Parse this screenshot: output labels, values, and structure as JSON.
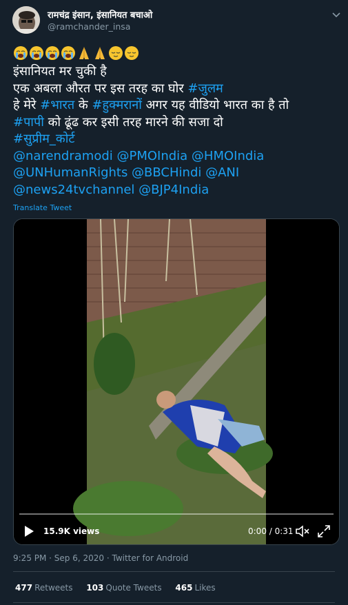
{
  "author": {
    "display_name": "रामचंद्र इंसान, इंसानियत बचाओ",
    "handle": "@ramchander_insa"
  },
  "emojis": [
    "crying-face",
    "crying-face",
    "crying-face",
    "crying-face",
    "folded-hands",
    "folded-hands",
    "relieved-face",
    "relieved-face"
  ],
  "tweet": {
    "line1": " इंसानियत मर चुकी है",
    "line2_text": "एक अबला औरत पर इस तरह का घोर ",
    "line2_tag": "#जुलम",
    "line3_a": " हे मेरे ",
    "line3_tag1": "#भारत",
    "line3_b": " के ",
    "line3_tag2": "#हुक्मरानों",
    "line3_c": " अगर यह वीडियो भारत का है तो",
    "line4_tag": "#पापी",
    "line4_text": " को ढूंढ कर इसी तरह मारने की सजा दो",
    "line5_tag": " #सुप्रीम_कोर्ट",
    "mentions1": "@narendramodi @PMOIndia @HMOIndia",
    "mentions2": "@UNHumanRights @BBCHindi @ANI",
    "mentions3": "@news24tvchannel @BJP4India"
  },
  "translate_label": "Translate Tweet",
  "video": {
    "views": "15.9K views",
    "time": "0:00 / 0:31",
    "progress": 0
  },
  "meta": "9:25 PM · Sep 6, 2020 · Twitter for Android",
  "stats": {
    "retweets_count": "477",
    "retweets_label": "Retweets",
    "quotes_count": "103",
    "quotes_label": "Quote Tweets",
    "likes_count": "465",
    "likes_label": "Likes"
  },
  "colors": {
    "background": "#15202b",
    "link": "#1da1f2",
    "muted": "#8899a6",
    "border": "#38444d"
  }
}
